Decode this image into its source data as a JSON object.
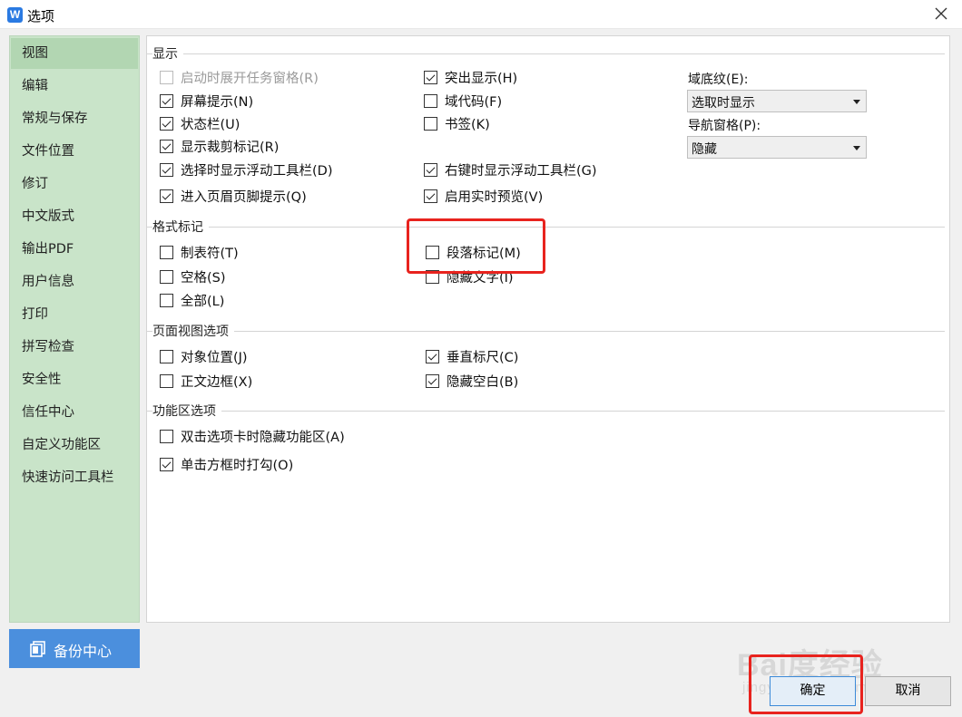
{
  "window": {
    "title": "选项",
    "app_icon": "W"
  },
  "sidebar": {
    "items": [
      {
        "label": "视图",
        "active": true
      },
      {
        "label": "编辑"
      },
      {
        "label": "常规与保存"
      },
      {
        "label": "文件位置"
      },
      {
        "label": "修订"
      },
      {
        "label": "中文版式"
      },
      {
        "label": "输出PDF"
      },
      {
        "label": "用户信息"
      },
      {
        "label": "打印"
      },
      {
        "label": "拼写检查"
      },
      {
        "label": "安全性"
      },
      {
        "label": "信任中心"
      },
      {
        "label": "自定义功能区"
      },
      {
        "label": "快速访问工具栏"
      }
    ],
    "backup_label": "备份中心"
  },
  "sections": {
    "display": {
      "title": "显示",
      "left": [
        {
          "label": "启动时展开任务窗格(R)",
          "checked": false,
          "disabled": true
        },
        {
          "label": "屏幕提示(N)",
          "checked": true
        },
        {
          "label": "状态栏(U)",
          "checked": true
        },
        {
          "label": "显示裁剪标记(R)",
          "checked": true
        },
        {
          "label": "选择时显示浮动工具栏(D)",
          "checked": true
        },
        {
          "label": "进入页眉页脚提示(Q)",
          "checked": true
        }
      ],
      "middle": [
        {
          "label": "突出显示(H)",
          "checked": true
        },
        {
          "label": "域代码(F)",
          "checked": false
        },
        {
          "label": "书签(K)",
          "checked": false
        },
        {
          "label": "右键时显示浮动工具栏(G)",
          "checked": true
        },
        {
          "label": "启用实时预览(V)",
          "checked": true
        }
      ],
      "field_shading": {
        "label": "域底纹(E):",
        "value": "选取时显示"
      },
      "nav_pane": {
        "label": "导航窗格(P):",
        "value": "隐藏"
      }
    },
    "format_marks": {
      "title": "格式标记",
      "left": [
        {
          "label": "制表符(T)",
          "checked": false
        },
        {
          "label": "空格(S)",
          "checked": false
        },
        {
          "label": "全部(L)",
          "checked": false
        }
      ],
      "middle": [
        {
          "label": "段落标记(M)",
          "checked": false
        },
        {
          "label": "隐藏文字(I)",
          "checked": false
        }
      ]
    },
    "page_view": {
      "title": "页面视图选项",
      "left": [
        {
          "label": "对象位置(J)",
          "checked": false
        },
        {
          "label": "正文边框(X)",
          "checked": false
        }
      ],
      "middle": [
        {
          "label": "垂直标尺(C)",
          "checked": true
        },
        {
          "label": "隐藏空白(B)",
          "checked": true
        }
      ]
    },
    "ribbon": {
      "title": "功能区选项",
      "left": [
        {
          "label": "双击选项卡时隐藏功能区(A)",
          "checked": false
        },
        {
          "label": "单击方框时打勾(O)",
          "checked": true
        }
      ]
    }
  },
  "buttons": {
    "ok": "确定",
    "cancel": "取消"
  },
  "watermark": {
    "logo": "Bai度经验",
    "url": "jingyan.baidu.com"
  },
  "colors": {
    "sidebar_bg": "#c9e4c9",
    "accent_blue": "#4b8fdd",
    "highlight_red": "#e8231e"
  }
}
